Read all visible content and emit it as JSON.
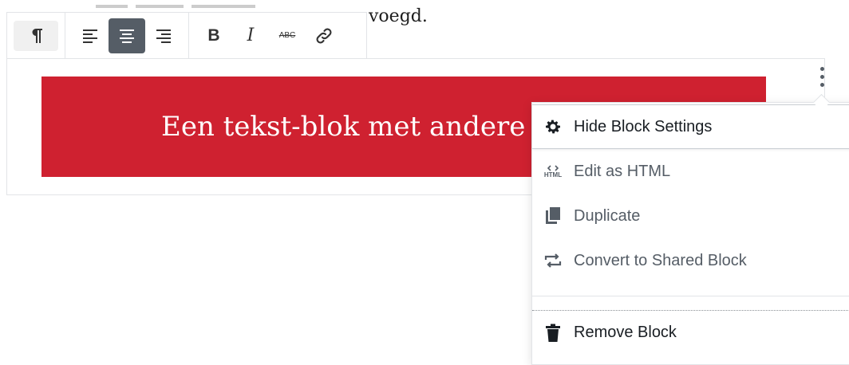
{
  "background": {
    "visible_text": "voegd."
  },
  "toolbar": {
    "paragraph_icon": "paragraph-icon",
    "align_left_icon": "align-left-icon",
    "align_center_icon": "align-center-icon",
    "align_right_icon": "align-right-icon",
    "bold_label": "B",
    "italic_label": "I",
    "strikethrough_label": "ABC",
    "link_icon": "link-icon"
  },
  "block": {
    "text": "Een tekst-blok met andere",
    "background_color": "#cf2130",
    "text_color": "#ffffff"
  },
  "more_menu": {
    "trigger_icon": "more-vertical-icon",
    "items": [
      {
        "label": "Hide Block Settings",
        "icon": "gear-icon"
      },
      {
        "label": "Edit as HTML",
        "icon": "html-icon",
        "icon_text": "HTML"
      },
      {
        "label": "Duplicate",
        "icon": "duplicate-icon"
      },
      {
        "label": "Convert to Shared Block",
        "icon": "convert-icon"
      },
      {
        "label": "Remove Block",
        "icon": "trash-icon"
      }
    ]
  },
  "colors": {
    "accent_dark": "#555d66",
    "border": "#e2e4e7"
  }
}
